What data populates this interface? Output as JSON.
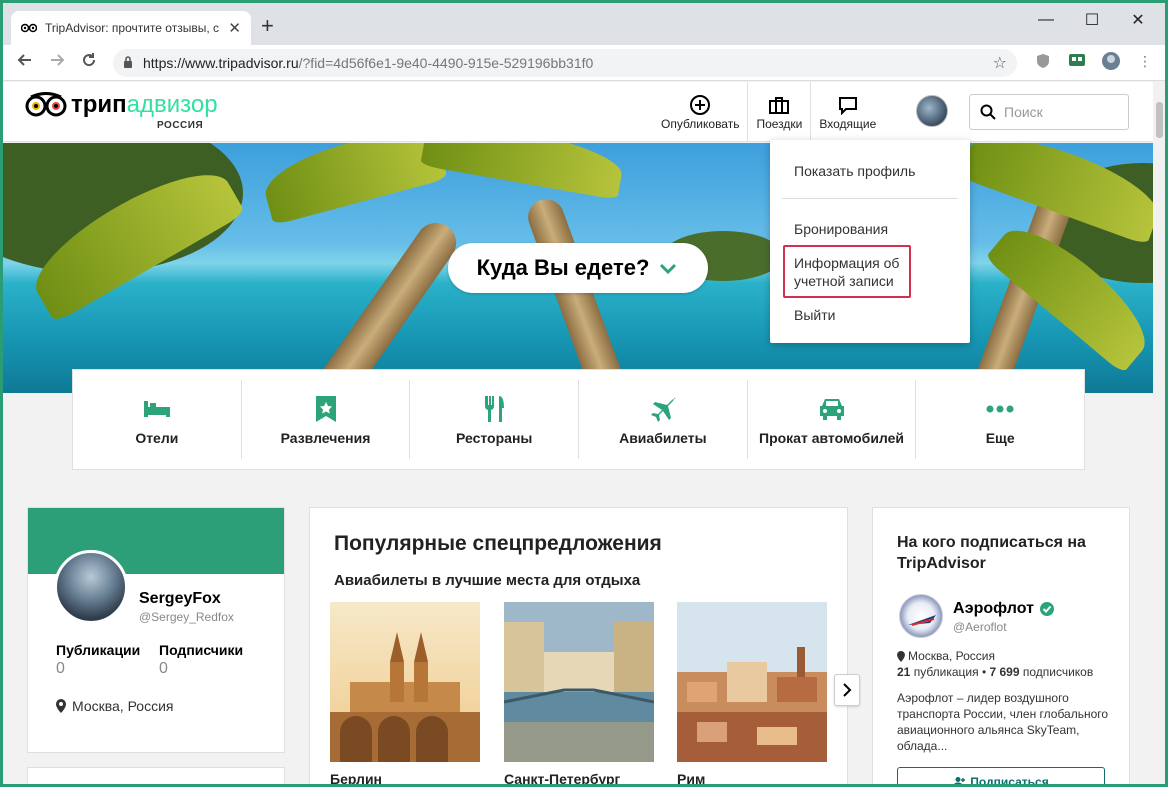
{
  "browser": {
    "tab_title": "TripAdvisor: прочтите отзывы, с",
    "tab_close": "✕",
    "new_tab": "+",
    "window_controls": {
      "minimize": "—",
      "maximize": "☐",
      "close": "✕"
    },
    "url_host": "https://www.tripadvisor.ru",
    "url_path": "/?fid=4d56f6e1-9e40-4490-915e-529196bb31f0"
  },
  "header": {
    "logo_dark": "трип",
    "logo_green": "адвизор",
    "logo_country": "РОССИЯ",
    "nav": [
      {
        "label": "Опубликовать",
        "icon": "plus-circle-icon"
      },
      {
        "label": "Поездки",
        "icon": "suitcase-icon"
      },
      {
        "label": "Входящие",
        "icon": "chat-icon"
      }
    ],
    "search_placeholder": "Поиск"
  },
  "hero": {
    "prompt": "Куда Вы едете?"
  },
  "user_menu": {
    "items": [
      "Показать профиль",
      "Бронирования",
      "Информация об учетной записи",
      "Выйти"
    ],
    "highlighted_line1": "Информация об",
    "highlighted_line2": "учетной записи"
  },
  "categories": [
    {
      "label": "Отели",
      "icon": "bed-icon"
    },
    {
      "label": "Развлечения",
      "icon": "ticket-icon"
    },
    {
      "label": "Рестораны",
      "icon": "fork-knife-icon"
    },
    {
      "label": "Авиабилеты",
      "icon": "plane-icon"
    },
    {
      "label": "Прокат автомобилей",
      "icon": "car-icon"
    },
    {
      "label": "Еще",
      "icon": "more-dots-icon"
    }
  ],
  "profile": {
    "name": "SergeyFox",
    "handle": "@Sergey_Redfox",
    "publications_label": "Публикации",
    "publications_value": "0",
    "followers_label": "Подписчики",
    "followers_value": "0",
    "location": "Москва, Россия"
  },
  "specials": {
    "title": "Популярные спецпредложения",
    "subtitle": "Авиабилеты в лучшие места для отдыха",
    "destinations": [
      "Берлин",
      "Санкт-Петербург",
      "Рим"
    ]
  },
  "follow": {
    "title": "На кого подписаться на TripAdvisor",
    "name": "Аэрофлот",
    "handle": "@Aeroflot",
    "location": "Москва, Россия",
    "pubs_count": "21",
    "pubs_label": " публикация • ",
    "followers_count": "7 699",
    "followers_label": " подписчиков",
    "description": "Аэрофлот – лидер воздушного транспорта России, член глобального авиационного альянса SkyTeam, облада...",
    "button": "Подписаться"
  },
  "colors": {
    "frame": "#2a9d74",
    "brand_green": "#34e0a1",
    "category_green": "#2da37a",
    "profile_band": "#2d9f78",
    "highlight": "#d32f4e"
  }
}
